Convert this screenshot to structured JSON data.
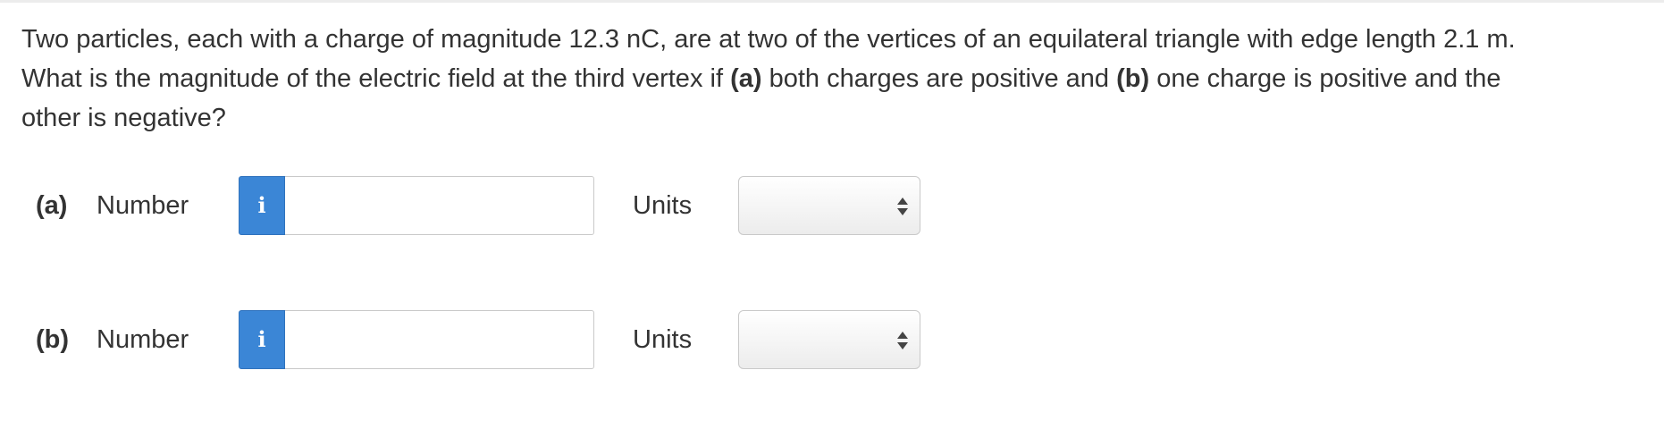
{
  "question": {
    "line1": "Two particles, each with a charge of magnitude 12.3 nC, are at two of the vertices of an equilateral triangle with edge length 2.1 m.",
    "line2_start": "What is the magnitude of the electric field at the third vertex if ",
    "part_a_marker": "(a)",
    "line2_mid": " both charges are positive and ",
    "part_b_marker": "(b)",
    "line2_end": " one charge is positive and the",
    "line3": "other is negative?"
  },
  "answers": [
    {
      "part_label": "(a)",
      "number_label": "Number",
      "info_icon": "i",
      "number_value": "",
      "number_placeholder": "",
      "units_label": "Units",
      "units_selected": ""
    },
    {
      "part_label": "(b)",
      "number_label": "Number",
      "info_icon": "i",
      "number_value": "",
      "number_placeholder": "",
      "units_label": "Units",
      "units_selected": ""
    }
  ],
  "icons": {
    "info": "info-icon",
    "select_arrows": "up-down-arrows-icon"
  },
  "colors": {
    "info_button": "#3b86d6",
    "text": "#333333",
    "border": "#c9c9c9"
  }
}
